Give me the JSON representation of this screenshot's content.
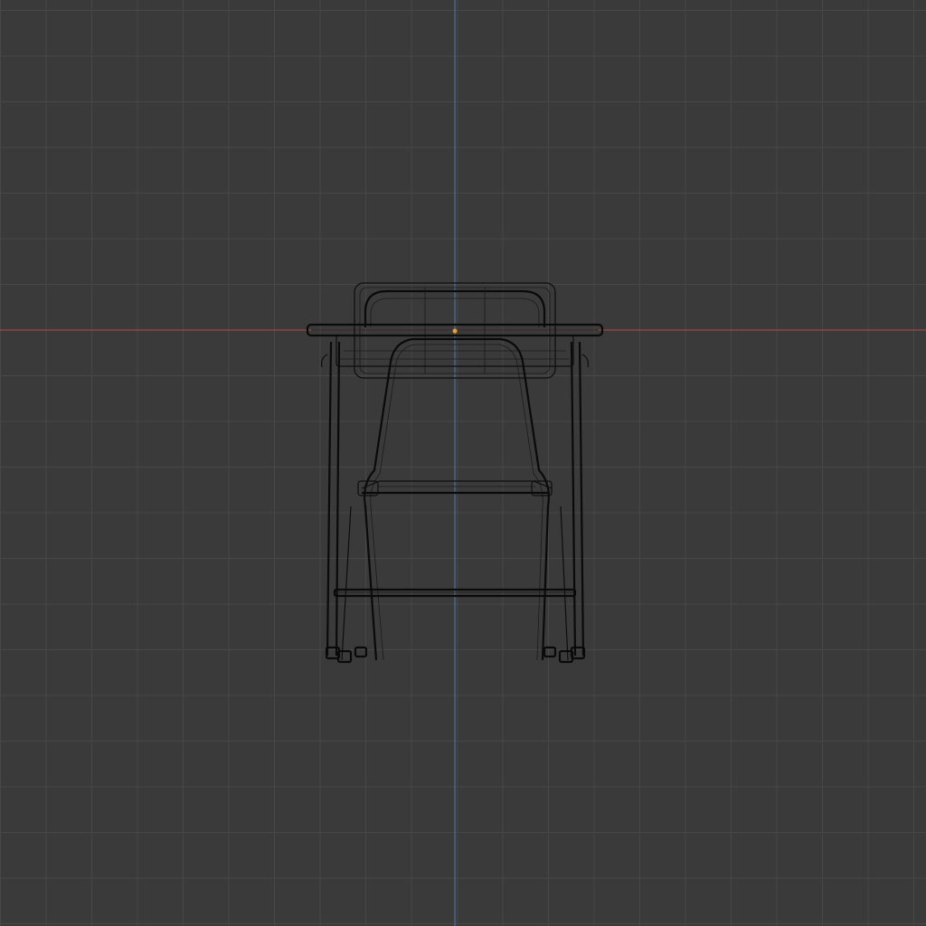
{
  "viewport": {
    "background_color": "#3a3a3a",
    "grid_color": "#474747",
    "axis_x_color": "#b34a4a",
    "axis_z_color": "#4a7fb3",
    "origin_color": "#f0a020",
    "wire_color": "#0d0d0d"
  },
  "scene": {
    "object": "chair",
    "shading": "wireframe",
    "icons": [
      "origin-dot-icon"
    ]
  }
}
